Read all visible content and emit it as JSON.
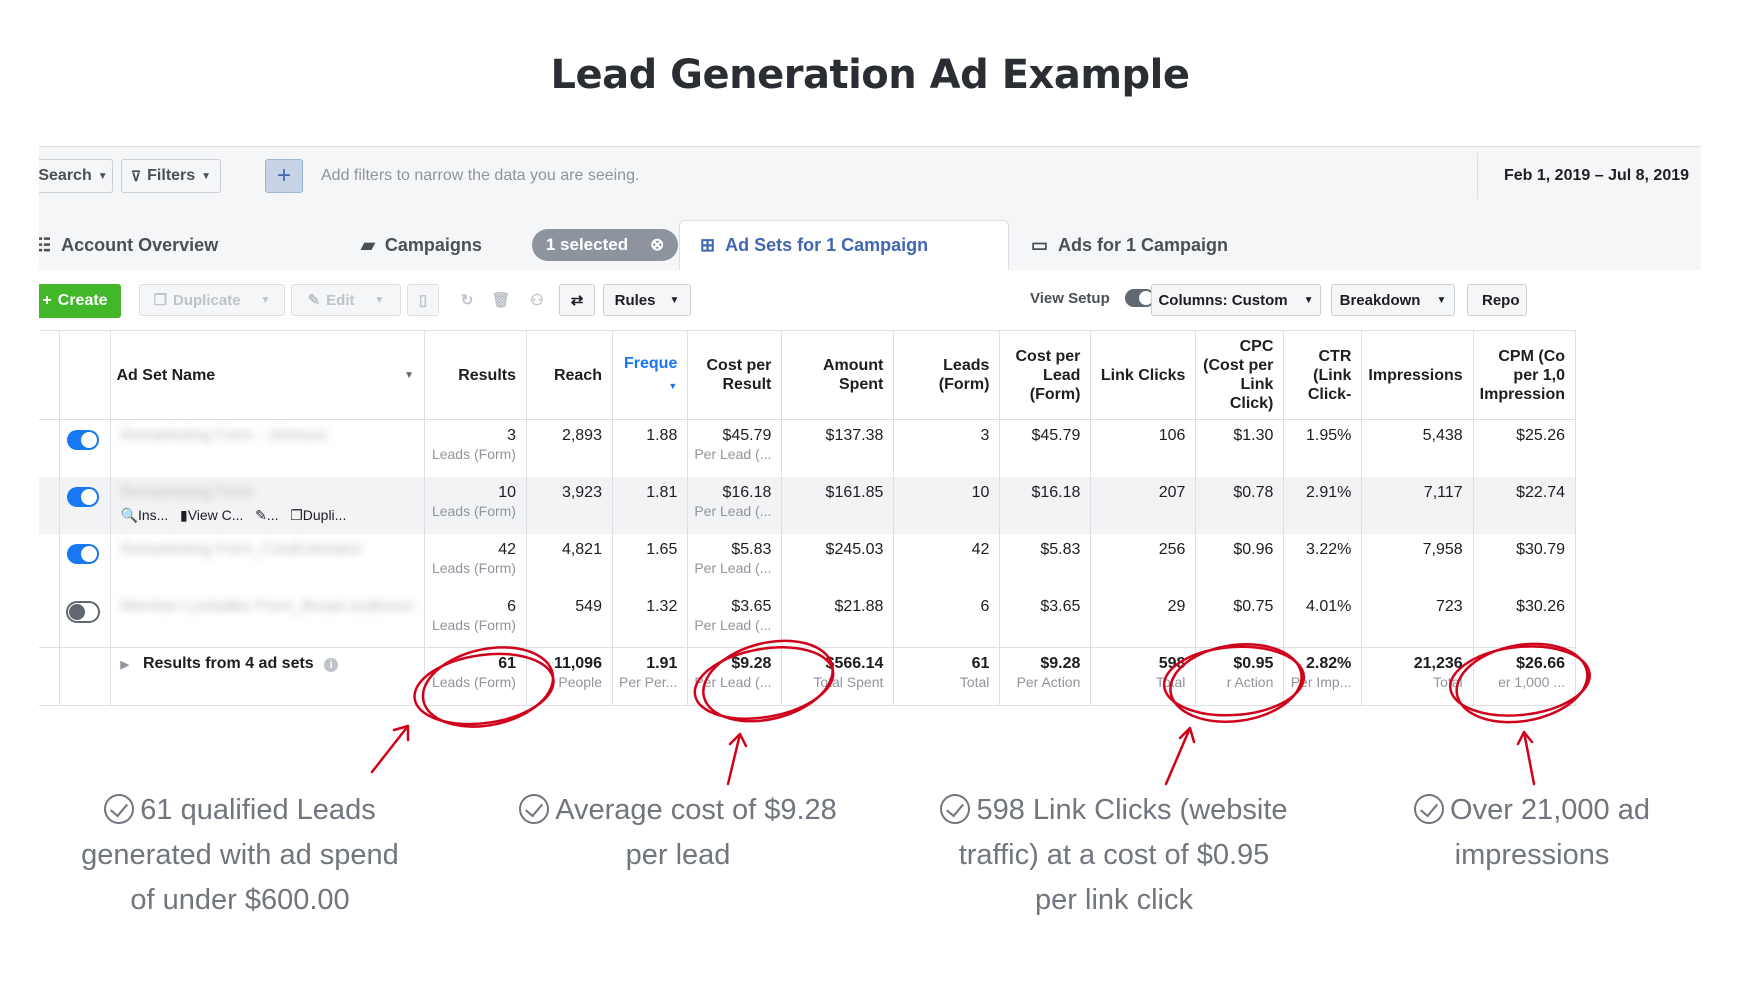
{
  "title": "Lead Generation Ad Example",
  "filterbar": {
    "search_label": "Search",
    "filters_label": "Filters",
    "placeholder": "Add filters to narrow the data you are seeing.",
    "date_range": "Feb 1, 2019 – Jul 8, 2019"
  },
  "tabs": {
    "account_overview": "Account Overview",
    "campaigns": "Campaigns",
    "selected": "1 selected",
    "ad_sets": "Ad Sets for 1 Campaign",
    "ads": "Ads for 1 Campaign"
  },
  "toolbar": {
    "create": "Create",
    "duplicate": "Duplicate",
    "edit": "Edit",
    "rules": "Rules",
    "view_setup": "View Setup",
    "columns": "Columns: Custom",
    "breakdown": "Breakdown",
    "reports": "Repo"
  },
  "columns": {
    "name": "Ad Set Name",
    "results": "Results",
    "reach": "Reach",
    "frequency": "Freque",
    "cost_per_result": "Cost per Result",
    "amount_spent": "Amount Spent",
    "leads_form": "Leads (Form)",
    "cost_per_lead": "Cost per Lead (Form)",
    "link_clicks": "Link Clicks",
    "cpc": "CPC (Cost per Link Click)",
    "ctr": "CTR (Link Click-",
    "impressions": "Impressions",
    "cpm": "CPM (Co per 1,0 Impression"
  },
  "rows": [
    {
      "name": "Remarketing Form - Johnson",
      "on": true,
      "results": "3",
      "results_sub": "Leads (Form)",
      "reach": "2,893",
      "frequency": "1.88",
      "cpr": "$45.79",
      "cpr_sub": "Per Lead (...",
      "spent": "$137.38",
      "leads": "3",
      "cpl": "$45.79",
      "clicks": "106",
      "cpc": "$1.30",
      "ctr": "1.95%",
      "impressions": "5,438",
      "cpm": "$25.26"
    },
    {
      "name": "Remarketing Form",
      "on": true,
      "results": "10",
      "results_sub": "Leads (Form)",
      "reach": "3,923",
      "frequency": "1.81",
      "cpr": "$16.18",
      "cpr_sub": "Per Lead (...",
      "spent": "$161.85",
      "leads": "10",
      "cpl": "$16.18",
      "clicks": "207",
      "cpc": "$0.78",
      "ctr": "2.91%",
      "impressions": "7,117",
      "cpm": "$22.74"
    },
    {
      "name": "Remarketing Form_CostEstimator",
      "on": true,
      "results": "42",
      "results_sub": "Leads (Form)",
      "reach": "4,821",
      "frequency": "1.65",
      "cpr": "$5.83",
      "cpr_sub": "Per Lead (...",
      "spent": "$245.03",
      "leads": "42",
      "cpl": "$5.83",
      "clicks": "256",
      "cpc": "$0.96",
      "ctr": "3.22%",
      "impressions": "7,958",
      "cpm": "$30.79"
    },
    {
      "name": "Member Lookalike Form_Broad audience",
      "on": false,
      "results": "6",
      "results_sub": "Leads (Form)",
      "reach": "549",
      "frequency": "1.32",
      "cpr": "$3.65",
      "cpr_sub": "Per Lead (...",
      "spent": "$21.88",
      "leads": "6",
      "cpl": "$3.65",
      "clicks": "29",
      "cpc": "$0.75",
      "ctr": "4.01%",
      "impressions": "723",
      "cpm": "$30.26"
    }
  ],
  "row_actions": {
    "inspect": "Ins...",
    "view": "View C...",
    "edit": "...",
    "duplicate": "Dupli..."
  },
  "totals": {
    "label": "Results from 4 ad sets",
    "results": "61",
    "results_sub": "Leads (Form)",
    "reach": "11,096",
    "reach_sub": "People",
    "frequency": "1.91",
    "frequency_sub": "Per Per...",
    "cpr": "$9.28",
    "cpr_sub": "Per Lead (...",
    "spent": "$566.14",
    "spent_sub": "Total Spent",
    "leads": "61",
    "leads_sub": "Total",
    "cpl": "$9.28",
    "cpl_sub": "Per Action",
    "clicks": "598",
    "clicks_sub": "Total",
    "cpc": "$0.95",
    "cpc_sub": "r Action",
    "ctr": "2.82%",
    "ctr_sub": "Per Imp...",
    "impressions": "21,236",
    "impressions_sub": "Total",
    "cpm": "$26.66",
    "cpm_sub": "er 1,000 ..."
  },
  "annotations": [
    {
      "lines": [
        "61 qualified Leads",
        "generated with ad spend",
        "of under $600.00"
      ]
    },
    {
      "lines": [
        "Average cost of $9.28",
        "per lead"
      ]
    },
    {
      "lines": [
        "598 Link Clicks (website",
        "traffic) at a cost of $0.95",
        "per link click"
      ]
    },
    {
      "lines": [
        "Over 21,000 ad",
        "impressions"
      ]
    }
  ],
  "colors": {
    "accent": "#4267b2",
    "create": "#42b72a",
    "toggle_on": "#1877f2",
    "marker": "#d0021b"
  }
}
